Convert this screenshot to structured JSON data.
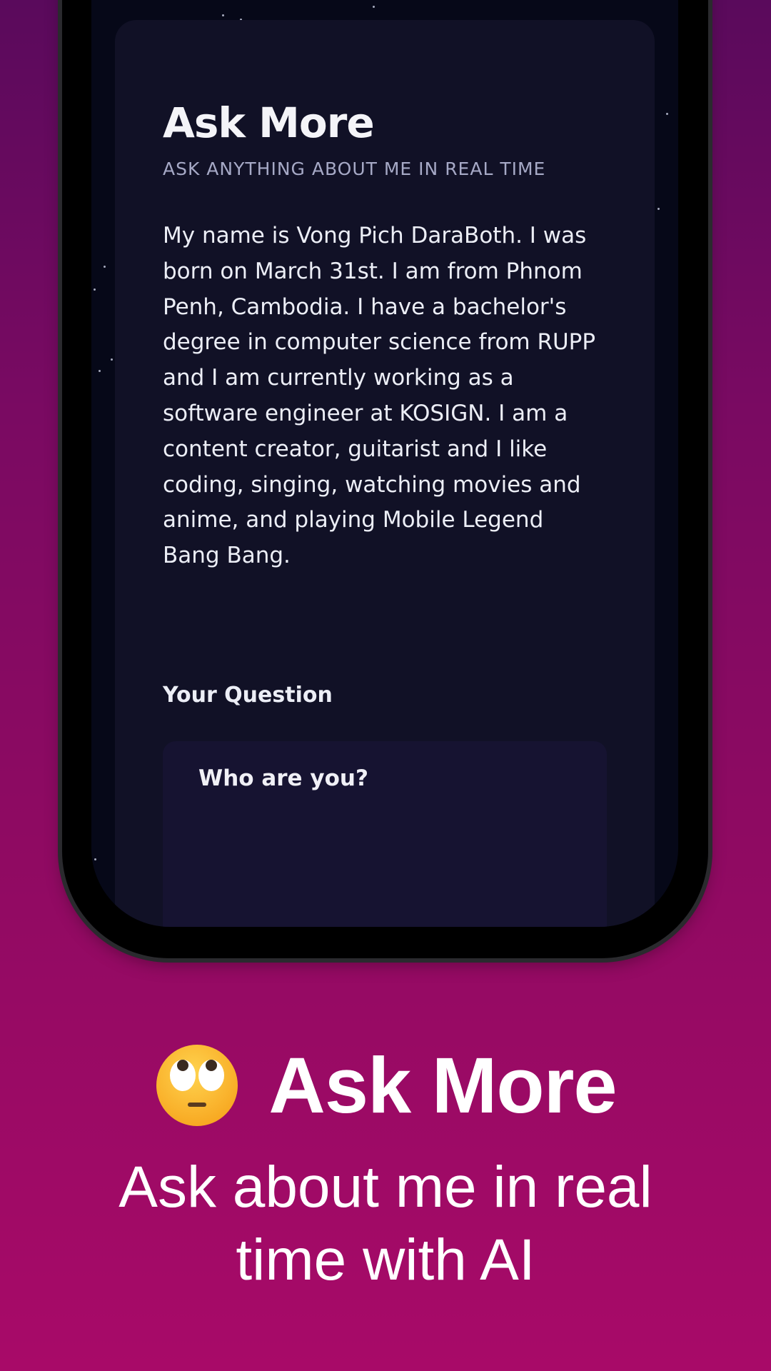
{
  "card": {
    "title": "Ask More",
    "subtitle": "ASK ANYTHING ABOUT ME IN REAL TIME",
    "bio": "My name is Vong Pich DaraBoth. I was born on March 31st. I am from Phnom Penh, Cambodia. I have a bachelor's degree in computer science from RUPP and I am currently working as a software engineer at KOSIGN. I am a content creator, guitarist and I like coding, singing, watching movies and anime, and playing Mobile Legend Bang Bang.",
    "question_label": "Your Question",
    "question_value": "Who are you?"
  },
  "promo": {
    "emoji_icon": "face-with-rolling-eyes-icon",
    "title": "Ask More",
    "subtitle": "Ask about me in real time with AI"
  },
  "colors": {
    "background_top": "#5a0a5c",
    "background_bottom": "#a80a68",
    "screen": "#060818",
    "card": "#111126",
    "input": "#161331"
  }
}
